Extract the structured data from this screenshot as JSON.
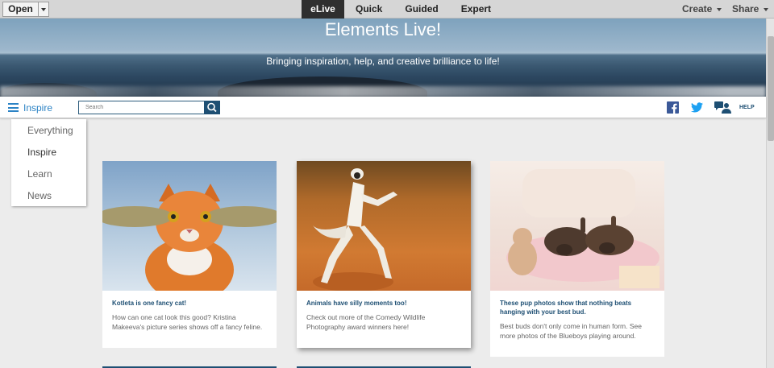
{
  "toolbar": {
    "open_label": "Open",
    "modes": [
      "eLive",
      "Quick",
      "Guided",
      "Expert"
    ],
    "create_label": "Create",
    "share_label": "Share"
  },
  "hero": {
    "title": "Elements Live!",
    "subtitle": "Bringing inspiration, help, and creative brilliance to life!"
  },
  "nav": {
    "category_label": "Inspire",
    "search_placeholder": "Search",
    "help_label": "HELP",
    "dropdown_items": [
      "Everything",
      "Inspire",
      "Learn",
      "News"
    ]
  },
  "cards": [
    {
      "title": "Kotleta is one fancy cat!",
      "description": "How can one cat look this good? Kristina Makeeva's picture series shows off a fancy feline."
    },
    {
      "title": "Animals have silly moments too!",
      "description": "Check out more of the Comedy Wildlife Photography award winners here!"
    },
    {
      "title": "These pup photos show that nothing beats hanging with your best bud.",
      "description": "Best buds don't only come in human form. See more photos of the Blueboys playing around."
    }
  ],
  "colors": {
    "accent": "#2c83c5",
    "dark_blue": "#1e4f73",
    "facebook": "#3b5998",
    "twitter": "#1da1f2"
  }
}
